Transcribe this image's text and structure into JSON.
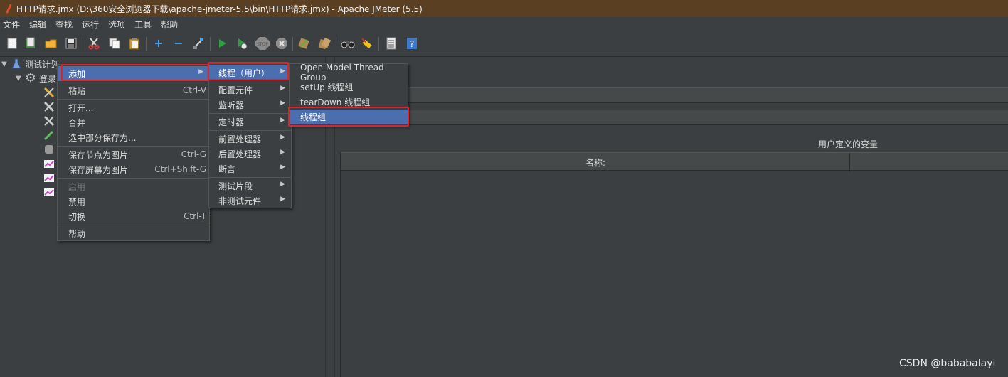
{
  "window": {
    "title": "HTTP请求.jmx (D:\\360安全浏览器下载\\apache-jmeter-5.5\\bin\\HTTP请求.jmx) - Apache JMeter (5.5)"
  },
  "menubar": [
    "文件",
    "编辑",
    "查找",
    "运行",
    "选项",
    "工具",
    "帮助"
  ],
  "toolbar": {
    "icons": [
      "new-icon",
      "templates-icon",
      "open-icon",
      "save-icon",
      "cut-icon",
      "copy-icon",
      "paste-icon",
      "expand-icon",
      "collapse-icon",
      "toggle-icon",
      "start-icon",
      "start-no-pause-icon",
      "stop-icon",
      "shutdown-icon",
      "clear-icon",
      "clear-all-icon",
      "search-icon",
      "reset-search-icon",
      "function-helper-icon",
      "help-icon"
    ],
    "colors": {
      "run": "#2ea043",
      "stop": "#8c8c8c",
      "add": "#4aa3f0"
    }
  },
  "tree": {
    "root_label": "测试计划",
    "child_label": "登录"
  },
  "context_menu": {
    "items": [
      {
        "label": "添加",
        "shortcut": "",
        "submenu": true,
        "selected": true
      },
      {
        "label": "粘贴",
        "shortcut": "Ctrl-V"
      },
      {
        "label": "打开..."
      },
      {
        "label": "合并"
      },
      {
        "label": "选中部分保存为..."
      },
      {
        "label": "保存节点为图片",
        "shortcut": "Ctrl-G"
      },
      {
        "label": "保存屏幕为图片",
        "shortcut": "Ctrl+Shift-G"
      },
      {
        "label": "启用",
        "disabled": true
      },
      {
        "label": "禁用"
      },
      {
        "label": "切换",
        "shortcut": "Ctrl-T"
      },
      {
        "label": "帮助"
      }
    ]
  },
  "add_menu": {
    "items": [
      "线程（用户）",
      "配置元件",
      "监听器",
      "定时器",
      "前置处理器",
      "后置处理器",
      "断言",
      "测试片段",
      "非测试元件"
    ]
  },
  "thread_menu": {
    "items": [
      "Open Model Thread Group",
      "setUp 线程组",
      "tearDown 线程组",
      "线程组"
    ]
  },
  "panel": {
    "variables_caption": "用户定义的变量",
    "name_column": "名称:"
  },
  "watermark": "CSDN @bababalayi",
  "highlight_color": "#e0232a",
  "selection_color": "#4b6eaf"
}
